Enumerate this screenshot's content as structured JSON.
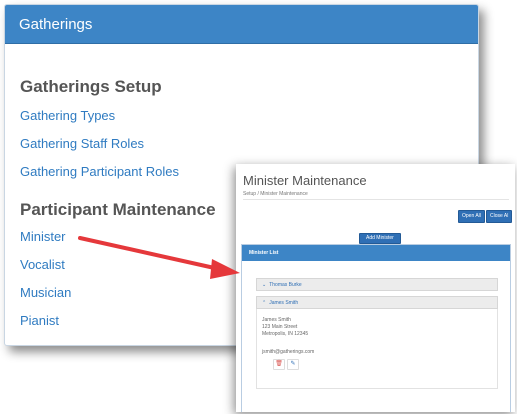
{
  "panel": {
    "title": "Gatherings",
    "setup_heading": "Gatherings Setup",
    "setup_links": [
      "Gathering Types",
      "Gathering Staff Roles",
      "Gathering Participant Roles"
    ],
    "participant_heading": "Participant Maintenance",
    "participant_links": [
      "Minister",
      "Vocalist",
      "Musician",
      "Pianist"
    ]
  },
  "inset": {
    "title": "Minister Maintenance",
    "breadcrumb": "Setup  /  Minister Maintenance",
    "open_all": "Open All",
    "close_all": "Close Al",
    "add_button": "Add Minister",
    "list_title": "Minister List",
    "rows": [
      "Thomas Burke",
      "James Smith"
    ],
    "detail_name": "James Smith",
    "detail_street": "123 Main Street",
    "detail_city": "Metropolis, IN 12345",
    "detail_email": "jsmith@gatherings.com",
    "delete_icon": "trash-icon",
    "edit_icon": "edit-icon"
  },
  "colors": {
    "header_blue": "#3d85c6",
    "link_blue": "#2f7bc1",
    "arrow_red": "#e5383b"
  }
}
